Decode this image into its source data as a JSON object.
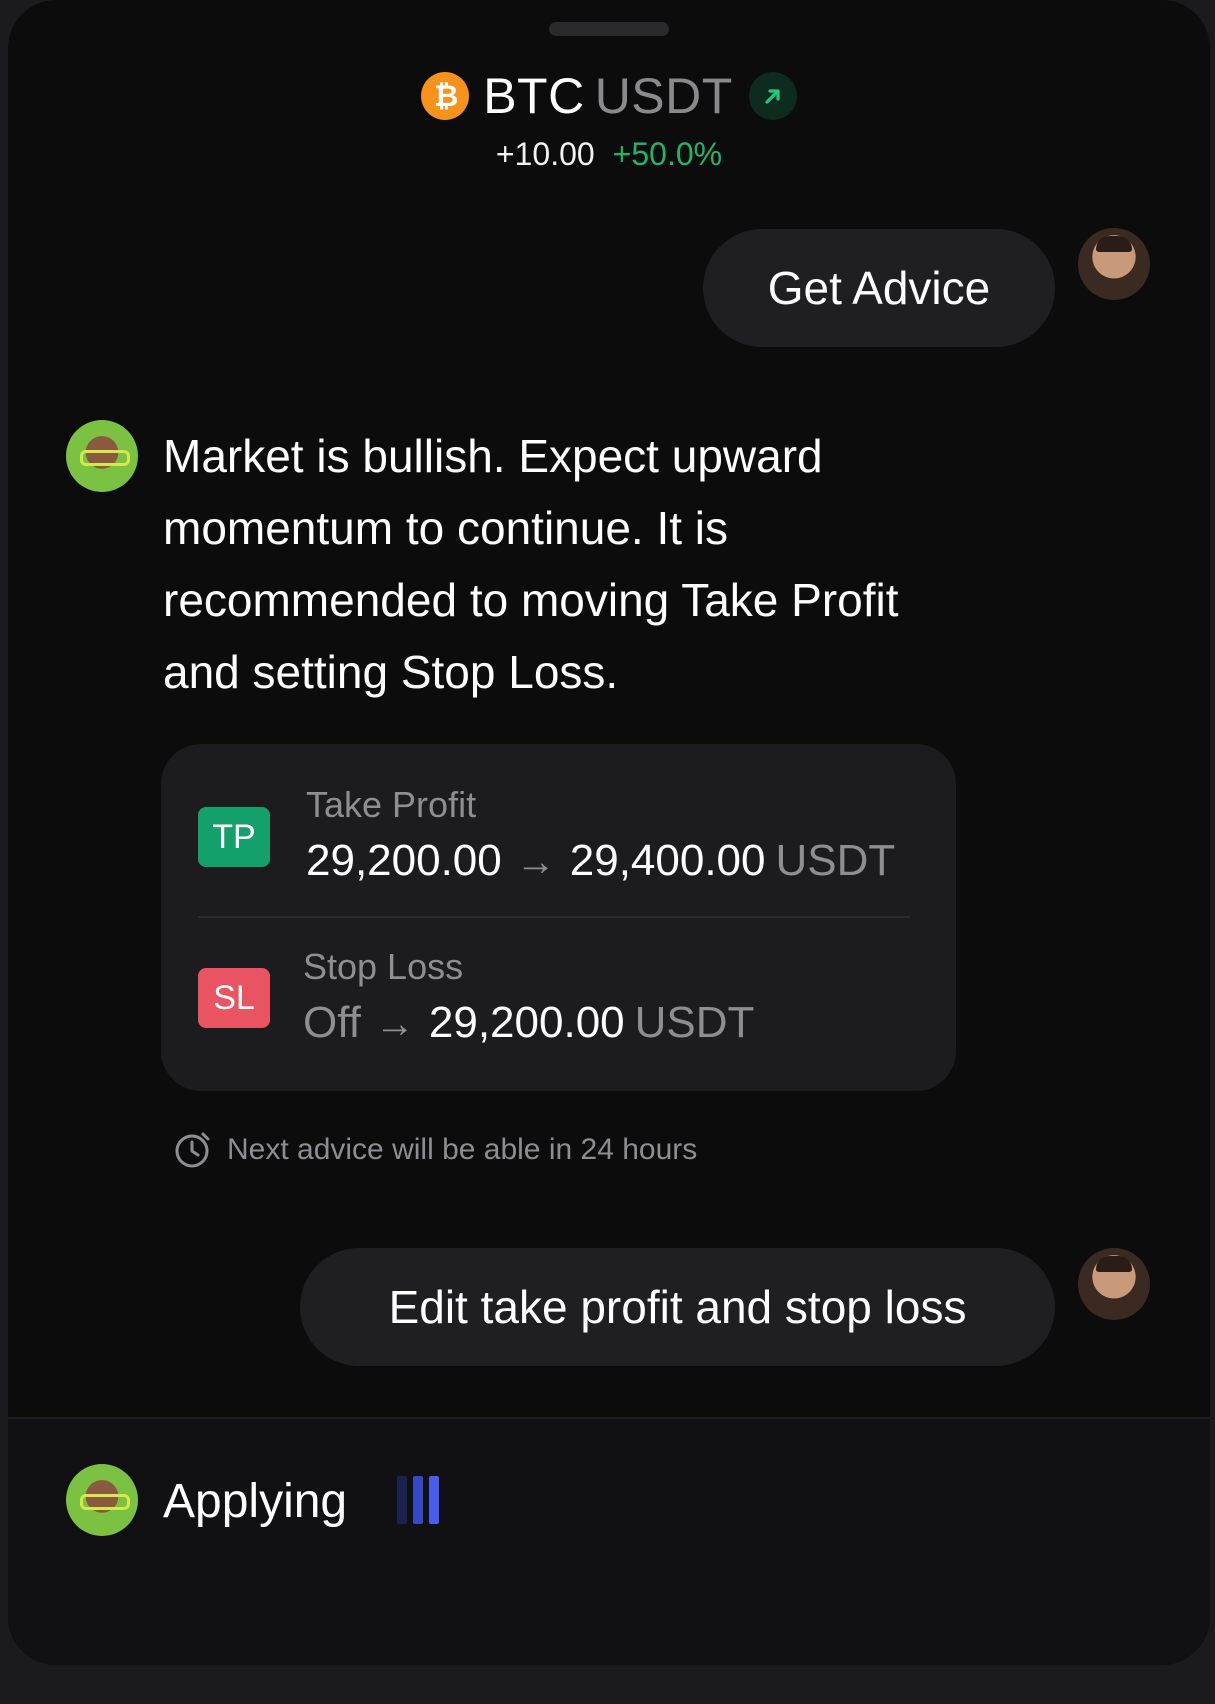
{
  "header": {
    "base": "BTC",
    "quote": "USDT",
    "change_abs": "+10.00",
    "change_pct": "+50.0%",
    "coin_icon": "bitcoin-icon",
    "trend_icon": "arrow-up-right-icon"
  },
  "chat": {
    "user_message_1": "Get Advice",
    "bot_message": "Market is bullish. Expect upward momentum to continue. It is recommended to moving Take Profit and setting Stop Loss.",
    "take_profit": {
      "badge": "TP",
      "label": "Take Profit",
      "from": "29,200.00",
      "to": "29,400.00",
      "unit": "USDT"
    },
    "stop_loss": {
      "badge": "SL",
      "label": "Stop Loss",
      "from": "Off",
      "to": "29,200.00",
      "unit": "USDT"
    },
    "note": "Next advice will be able in 24 hours",
    "user_message_2": "Edit take profit and stop loss"
  },
  "footer": {
    "status": "Applying"
  },
  "colors": {
    "positive": "#22b36a",
    "tp_badge": "#14a06a",
    "sl_badge": "#e85462",
    "bitcoin": "#f7931a",
    "loader_active": "#4a5cf0"
  }
}
